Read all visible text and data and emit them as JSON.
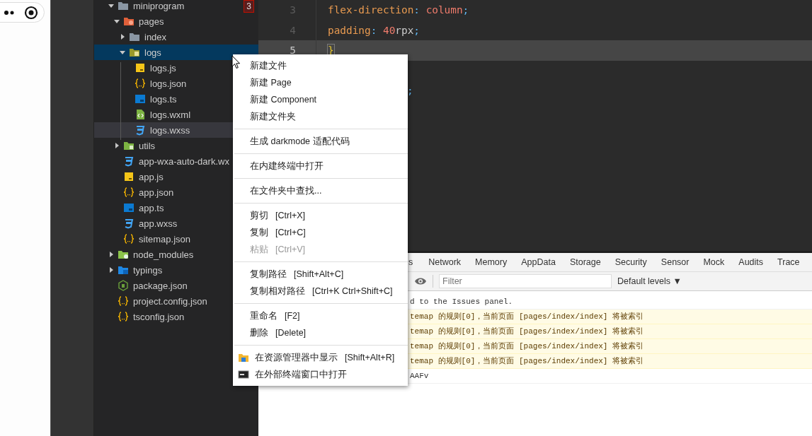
{
  "tree": [
    {
      "kind": "plain-folder",
      "name": "miniprogram",
      "expanded": true,
      "selected": false,
      "focused": false,
      "badge": "3",
      "children": [
        {
          "kind": "pages-folder",
          "name": "pages",
          "expanded": true,
          "selected": false,
          "focused": false,
          "children": [
            {
              "kind": "plain-folder",
              "name": "index",
              "expanded": false,
              "selected": false,
              "focused": false
            },
            {
              "kind": "logs-folder",
              "name": "logs",
              "expanded": true,
              "selected": true,
              "focused": false,
              "children": [
                {
                  "kind": "js-file",
                  "name": "logs.js",
                  "selected": false,
                  "focused": false
                },
                {
                  "kind": "json-file",
                  "name": "logs.json",
                  "selected": false,
                  "focused": false
                },
                {
                  "kind": "ts-file",
                  "name": "logs.ts",
                  "selected": false,
                  "focused": false
                },
                {
                  "kind": "wxml-file",
                  "name": "logs.wxml",
                  "selected": false,
                  "focused": false
                },
                {
                  "kind": "wxss-file",
                  "name": "logs.wxss",
                  "selected": false,
                  "focused": true
                }
              ]
            }
          ]
        },
        {
          "kind": "utils-folder",
          "name": "utils",
          "expanded": false,
          "selected": false,
          "focused": false
        },
        {
          "kind": "wxss-file",
          "name": "app-wxa-auto-dark.wx",
          "selected": false,
          "focused": false
        },
        {
          "kind": "js-file",
          "name": "app.js",
          "selected": false,
          "focused": false
        },
        {
          "kind": "json-file",
          "name": "app.json",
          "selected": false,
          "focused": false
        },
        {
          "kind": "ts-file",
          "name": "app.ts",
          "selected": false,
          "focused": false
        },
        {
          "kind": "wxss-file",
          "name": "app.wxss",
          "selected": false,
          "focused": false
        },
        {
          "kind": "json-file",
          "name": "sitemap.json",
          "selected": false,
          "focused": false
        }
      ]
    },
    {
      "kind": "node-folder",
      "name": "node_modules",
      "expanded": false,
      "selected": false,
      "focused": false
    },
    {
      "kind": "typings-folder",
      "name": "typings",
      "expanded": false,
      "selected": false,
      "focused": false
    },
    {
      "kind": "node-file",
      "name": "package.json",
      "selected": false,
      "focused": false
    },
    {
      "kind": "json-file",
      "name": "project.config.json",
      "selected": false,
      "focused": false
    },
    {
      "kind": "json-file",
      "name": "tsconfig.json",
      "selected": false,
      "focused": false
    }
  ],
  "editor": {
    "lines": [
      {
        "number": "3",
        "current": false,
        "tokens": [
          {
            "kind": "property",
            "text": "flex-direction"
          },
          {
            "kind": "punct",
            "text": ": "
          },
          {
            "kind": "value",
            "text": "column"
          },
          {
            "kind": "punct",
            "text": ";"
          }
        ]
      },
      {
        "number": "4",
        "current": false,
        "tokens": [
          {
            "kind": "property",
            "text": "padding"
          },
          {
            "kind": "punct",
            "text": ": "
          },
          {
            "kind": "value",
            "text": "40"
          },
          {
            "kind": "unit",
            "text": "rpx"
          },
          {
            "kind": "punct",
            "text": ";"
          }
        ]
      },
      {
        "number": "5",
        "current": true,
        "tokens": [
          {
            "kind": "brace",
            "text": "}"
          }
        ]
      }
    ],
    "overflow_text": ";"
  },
  "devtools": {
    "tabs": [
      {
        "label": "s",
        "selected": false
      },
      {
        "label": "Network",
        "selected": false
      },
      {
        "label": "Memory",
        "selected": false
      },
      {
        "label": "AppData",
        "selected": false
      },
      {
        "label": "Storage",
        "selected": false
      },
      {
        "label": "Security",
        "selected": false
      },
      {
        "label": "Sensor",
        "selected": false
      },
      {
        "label": "Mock",
        "selected": false
      },
      {
        "label": "Audits",
        "selected": false
      },
      {
        "label": "Trace",
        "selected": false
      }
    ],
    "filter": {
      "placeholder": "Filter"
    },
    "levels": "Default levels ▼",
    "messages": [
      {
        "kind": "info",
        "text": "d to the Issues panel."
      },
      {
        "kind": "warning",
        "text": "temap 的规则[0]，当前页面 [pages/index/index] 将被索引"
      },
      {
        "kind": "warning",
        "text": "temap 的规则[0]，当前页面 [pages/index/index] 将被索引"
      },
      {
        "kind": "warning",
        "text": "temap 的规则[0]，当前页面 [pages/index/index] 将被索引"
      },
      {
        "kind": "warning",
        "text": "temap 的规则[0]，当前页面 [pages/index/index] 将被索引"
      },
      {
        "kind": "info",
        "text": "AAFv"
      }
    ]
  },
  "context_menu": {
    "groups": [
      [
        {
          "label": "新建文件",
          "disabled": false
        },
        {
          "label": "新建 Page",
          "disabled": false
        },
        {
          "label": "新建 Component",
          "disabled": false
        },
        {
          "label": "新建文件夹",
          "disabled": false
        }
      ],
      [
        {
          "label": "生成 darkmode 适配代码",
          "disabled": false
        }
      ],
      [
        {
          "label": "在内建终端中打开",
          "disabled": false
        }
      ],
      [
        {
          "label": "在文件夹中查找...",
          "disabled": false
        }
      ],
      [
        {
          "label": "剪切",
          "shortcut": "[Ctrl+X]",
          "disabled": false
        },
        {
          "label": "复制",
          "shortcut": "[Ctrl+C]",
          "disabled": false
        },
        {
          "label": "粘贴",
          "shortcut": "[Ctrl+V]",
          "disabled": true
        }
      ],
      [
        {
          "label": "复制路径",
          "shortcut": "[Shift+Alt+C]",
          "disabled": false
        },
        {
          "label": "复制相对路径",
          "shortcut": "[Ctrl+K Ctrl+Shift+C]",
          "disabled": false
        }
      ],
      [
        {
          "label": "重命名",
          "shortcut": "[F2]",
          "disabled": false
        },
        {
          "label": "删除",
          "shortcut": "[Delete]",
          "disabled": false
        }
      ],
      [
        {
          "kind": "explorer",
          "label": "在资源管理器中显示",
          "shortcut": "[Shift+Alt+R]",
          "disabled": false
        },
        {
          "kind": "terminal",
          "label": "在外部终端窗口中打开",
          "disabled": false
        }
      ]
    ]
  }
}
